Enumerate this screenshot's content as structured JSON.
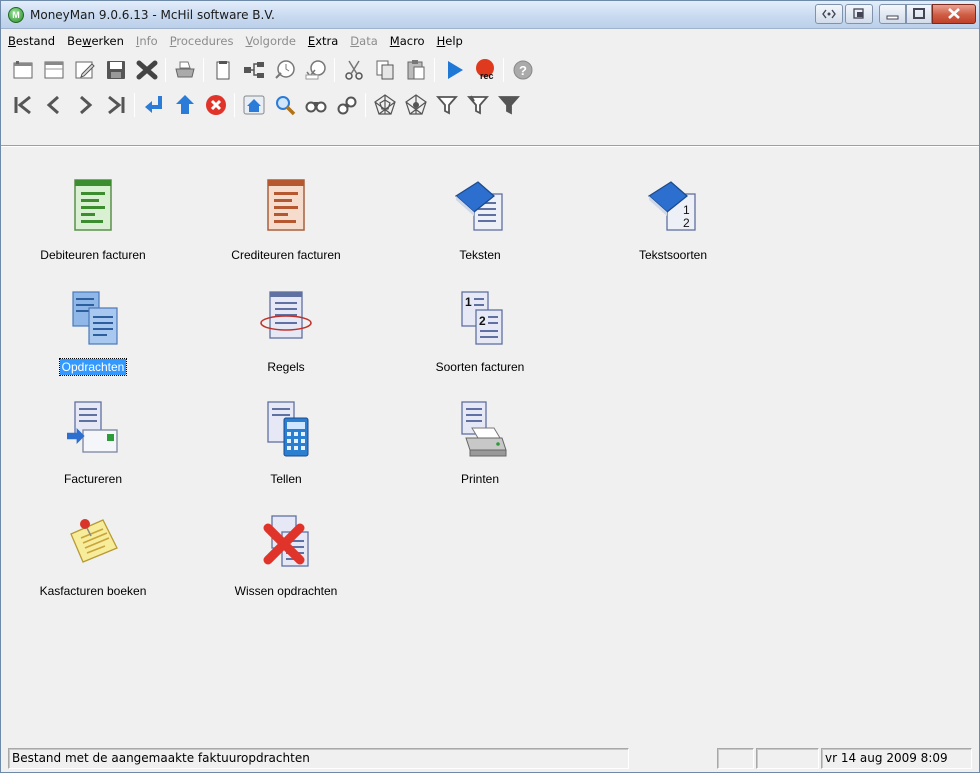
{
  "window": {
    "title": "MoneyMan 9.0.6.13 - McHil software B.V.",
    "app_icon_letter": "M"
  },
  "menu": [
    {
      "label": "Bestand",
      "accel": "B",
      "rest": "estand",
      "pre": "",
      "enabled": true
    },
    {
      "label": "Bewerken",
      "pre": "Be",
      "accel": "w",
      "rest": "erken",
      "enabled": true
    },
    {
      "label": "Info",
      "pre": "",
      "accel": "I",
      "rest": "nfo",
      "enabled": false
    },
    {
      "label": "Procedures",
      "pre": "",
      "accel": "P",
      "rest": "rocedures",
      "enabled": false
    },
    {
      "label": "Volgorde",
      "pre": "",
      "accel": "V",
      "rest": "olgorde",
      "enabled": false
    },
    {
      "label": "Extra",
      "pre": "",
      "accel": "E",
      "rest": "xtra",
      "enabled": true
    },
    {
      "label": "Data",
      "pre": "",
      "accel": "D",
      "rest": "ata",
      "enabled": false
    },
    {
      "label": "Macro",
      "pre": "",
      "accel": "M",
      "rest": "acro",
      "enabled": true
    },
    {
      "label": "Help",
      "pre": "",
      "accel": "H",
      "rest": "elp",
      "enabled": true
    }
  ],
  "toolbar1": [
    "new-record-icon",
    "window-icon",
    "edit-icon",
    "save-icon",
    "delete-icon",
    "print-icon",
    "clipboard-page-icon",
    "network-icon",
    "timer-icon",
    "timer-check-icon",
    "cut-icon",
    "copy-icon",
    "paste-icon",
    "play-macro-icon",
    "record-macro-icon",
    "help-icon"
  ],
  "toolbar2": [
    "first-record-icon",
    "previous-record-icon",
    "next-record-icon",
    "last-record-icon",
    "return-icon",
    "up-icon",
    "cancel-icon",
    "home-icon",
    "search-icon",
    "find-binoculars-icon",
    "find-next-binoculars-icon",
    "web-icon",
    "web-search-icon",
    "filter-icon",
    "filter-edit-icon",
    "filter-remove-icon"
  ],
  "tiles": [
    {
      "label": "Debiteuren facturen",
      "icon": "debtor-invoices-icon",
      "selected": false
    },
    {
      "label": "Crediteuren facturen",
      "icon": "creditor-invoices-icon",
      "selected": false
    },
    {
      "label": "Teksten",
      "icon": "texts-icon",
      "selected": false
    },
    {
      "label": "Tekstsoorten",
      "icon": "text-types-icon",
      "selected": false
    },
    {
      "label": "Opdrachten",
      "icon": "orders-icon",
      "selected": true
    },
    {
      "label": "Regels",
      "icon": "lines-icon",
      "selected": false
    },
    {
      "label": "Soorten facturen",
      "icon": "invoice-types-icon",
      "selected": false
    },
    {
      "label": "Factureren",
      "icon": "invoicing-icon",
      "selected": false
    },
    {
      "label": "Tellen",
      "icon": "count-calculator-icon",
      "selected": false
    },
    {
      "label": "Printen",
      "icon": "printer-icon",
      "selected": false
    },
    {
      "label": "Kasfacturen boeken",
      "icon": "cash-invoices-note-icon",
      "selected": false
    },
    {
      "label": "Wissen opdrachten",
      "icon": "delete-orders-icon",
      "selected": false
    }
  ],
  "status": {
    "message": "Bestand met de aangemaakte faktuuropdrachten",
    "panel2": "",
    "panel3": "",
    "datetime": "vr 14 aug 2009 8:09"
  }
}
